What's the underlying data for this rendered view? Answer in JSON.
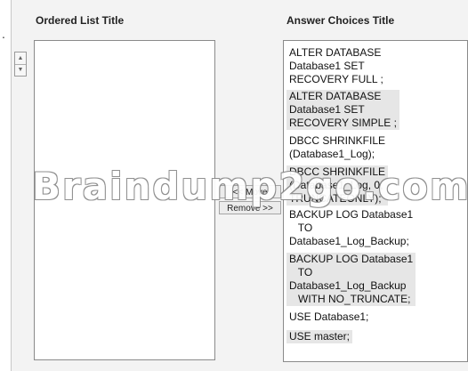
{
  "ordered_list": {
    "title": "Ordered List Title"
  },
  "answer_choices": {
    "title": "Answer Choices Title",
    "items": [
      "ALTER DATABASE\nDatabase1 SET\nRECOVERY FULL ;",
      "ALTER DATABASE\nDatabase1 SET\nRECOVERY SIMPLE ;",
      "DBCC SHRINKFILE\n(Database1_Log);",
      "DBCC SHRINKFILE\n(Database1_Log, 0,\nTRUNCATEONLY);",
      "BACKUP LOG Database1\n   TO\nDatabase1_Log_Backup;",
      "BACKUP LOG Database1\n   TO\nDatabase1_Log_Backup\n   WITH NO_TRUNCATE;",
      "USE Database1;",
      "USE master;"
    ]
  },
  "buttons": {
    "add_label": "<< Move",
    "remove_label": "Remove >>"
  },
  "spinner": {
    "up_icon": "arrow-up-icon",
    "down_icon": "arrow-down-icon"
  },
  "watermark": {
    "text": "Braindump2go.com"
  },
  "page_marker": "."
}
